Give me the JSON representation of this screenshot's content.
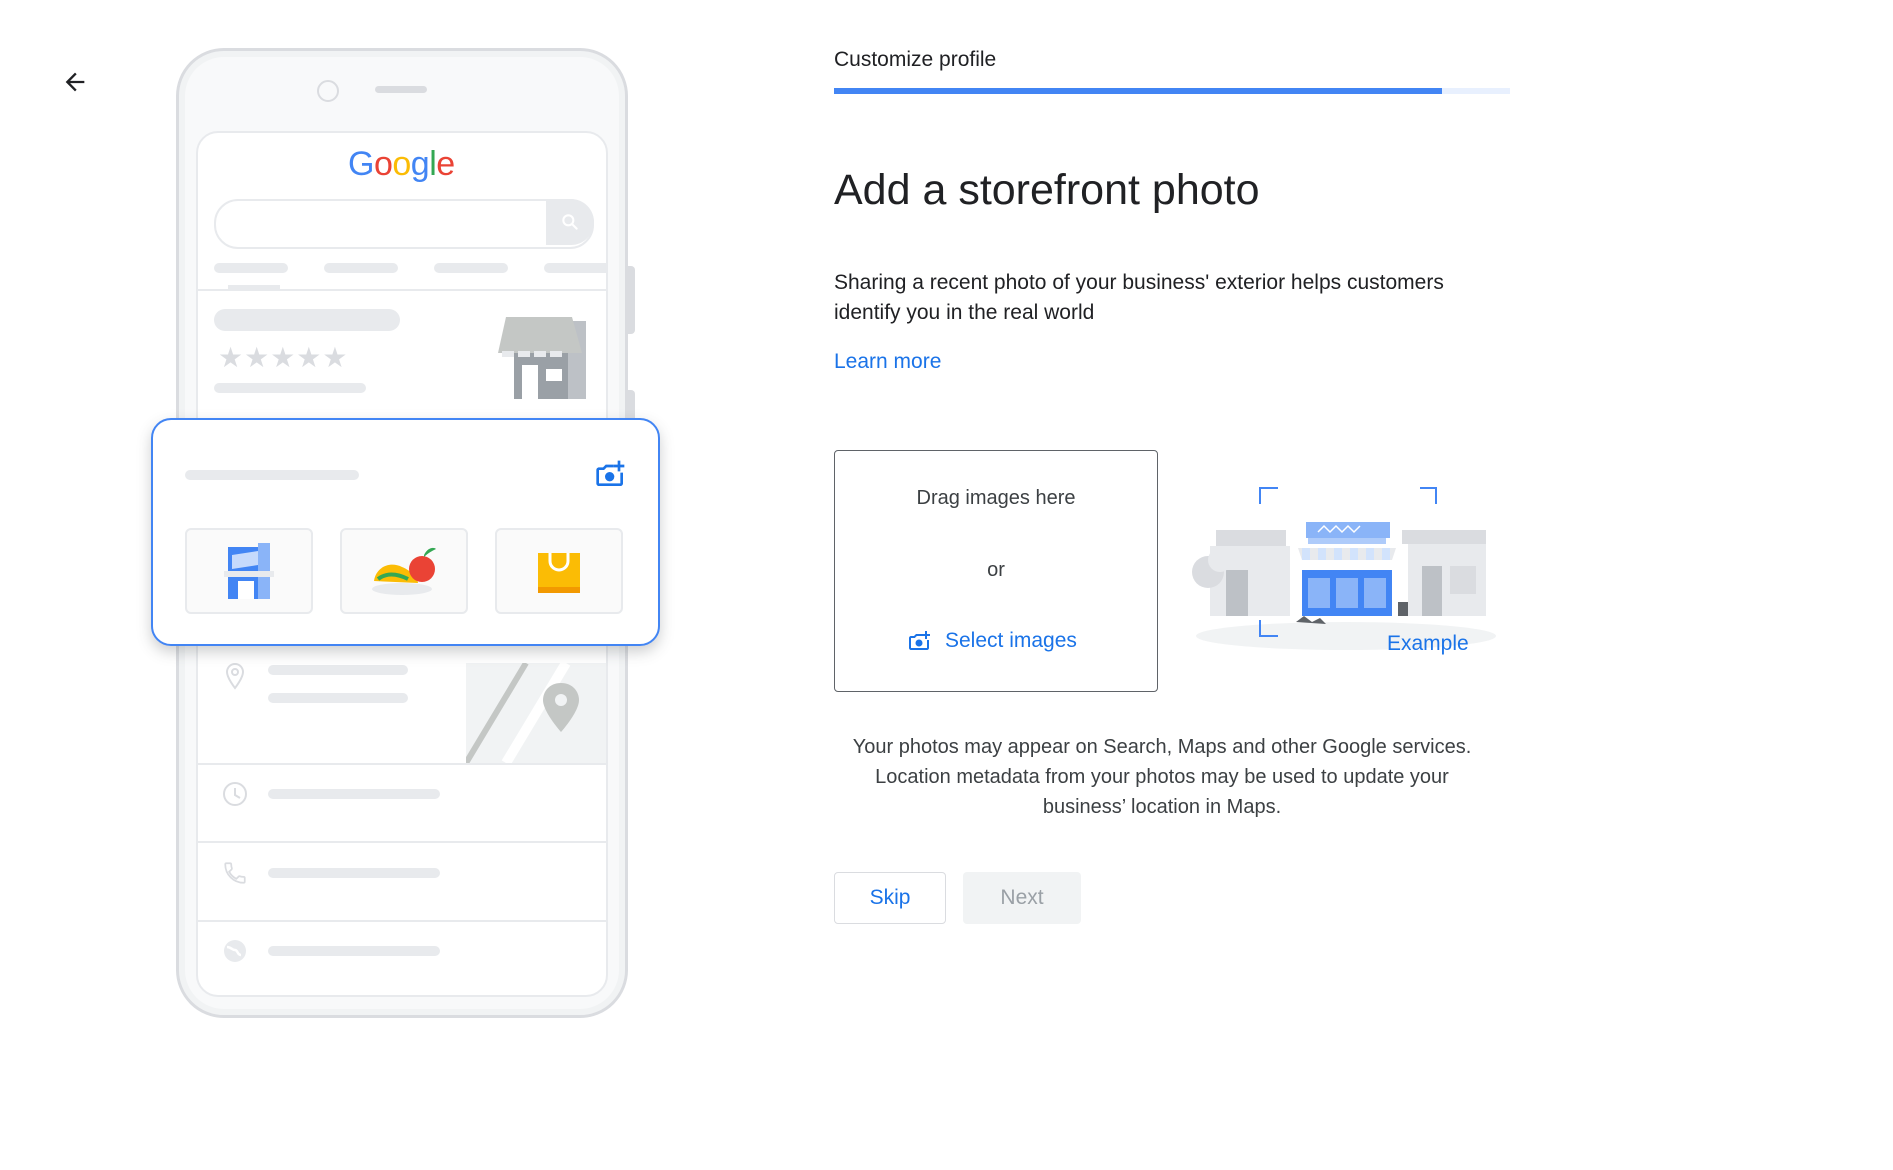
{
  "header": {
    "back_icon": "arrow-left-icon",
    "step_label": "Customize profile",
    "progress_fraction": 0.9
  },
  "illustration": {
    "brand_logo": "Google",
    "stars": "★★★★★",
    "icons": [
      "storefront-icon",
      "camera-add-icon",
      "food-icon",
      "shopping-bag-icon",
      "location-pin-icon",
      "clock-icon",
      "phone-icon",
      "globe-icon",
      "search-icon"
    ]
  },
  "main": {
    "title": "Add a storefront photo",
    "description": "Sharing a recent photo of your business' exterior helps customers identify you in the real world",
    "learn_more": "Learn more",
    "dropzone": {
      "drag_text": "Drag images here",
      "or_text": "or",
      "select_label": "Select images",
      "select_icon": "add-photo-icon"
    },
    "example_label": "Example",
    "notice": "Your photos may appear on Search, Maps and other Google services. Location metadata from your photos may be used to update your business’ location in Maps."
  },
  "actions": {
    "skip_label": "Skip",
    "next_label": "Next"
  },
  "colors": {
    "accent": "#1a73e8",
    "progress": "#4285f4",
    "card_border": "#4285f4",
    "disabled_bg": "#f1f3f4",
    "disabled_text": "#9aa0a6"
  }
}
